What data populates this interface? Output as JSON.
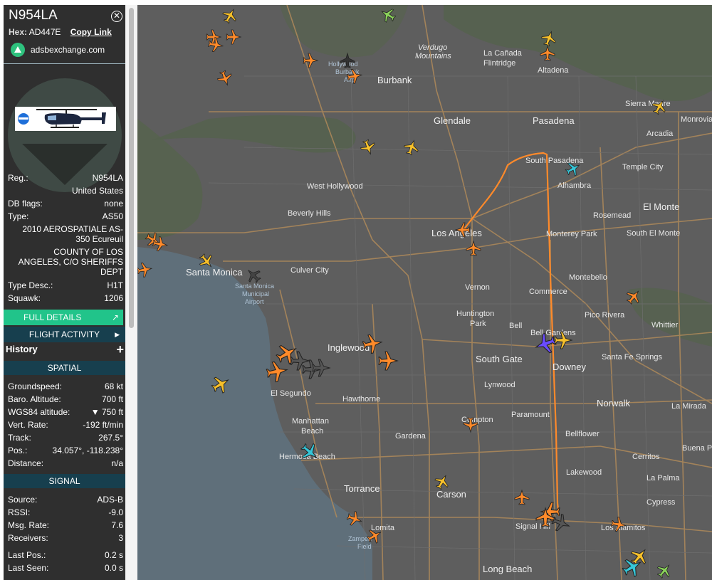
{
  "aircraft": {
    "callsign": "N954LA",
    "hex_label": "Hex:",
    "hex": "AD447E",
    "copy_link": "Copy Link",
    "source_site": "adsbexchange.com"
  },
  "details": {
    "reg_label": "Reg.:",
    "reg": "N954LA",
    "country": "United States",
    "db_flags_label": "DB flags:",
    "db_flags": "none",
    "type_label": "Type:",
    "type": "AS50",
    "model_line1": "2010 AEROSPATIALE AS-",
    "model_line2": "350 Ecureuil",
    "owner_line1": "COUNTY OF LOS",
    "owner_line2": "ANGELES, C/O SHERIFFS",
    "owner_line3": "DEPT",
    "type_desc_label": "Type Desc.:",
    "type_desc": "H1T",
    "squawk_label": "Squawk:",
    "squawk": "1206"
  },
  "buttons": {
    "full_details": "FULL DETAILS",
    "flight_activity": "FLIGHT ACTIVITY",
    "history": "History",
    "plus": "+"
  },
  "spatial": {
    "title": "SPATIAL",
    "groundspeed_label": "Groundspeed:",
    "groundspeed": "68 kt",
    "baro_label": "Baro. Altitude:",
    "baro": "700 ft",
    "wgs_label": "WGS84 altitude:",
    "wgs": "▼ 750 ft",
    "vrate_label": "Vert. Rate:",
    "vrate": "-192 ft/min",
    "track_label": "Track:",
    "track": "267.5°",
    "pos_label": "Pos.:",
    "pos": "34.057°, -118.238°",
    "distance_label": "Distance:",
    "distance": "n/a"
  },
  "signal": {
    "title": "SIGNAL",
    "source_label": "Source:",
    "source": "ADS-B",
    "rssi_label": "RSSI:",
    "rssi": "-9.0",
    "msgrate_label": "Msg. Rate:",
    "msgrate": "7.6",
    "receivers_label": "Receivers:",
    "receivers": "3",
    "lastpos_label": "Last Pos.:",
    "lastpos": "0.2 s",
    "lastseen_label": "Last Seen:",
    "lastseen": "0.0 s"
  },
  "colors": {
    "track": "#ff8a2a",
    "plane_orange": "#ff8a2a",
    "plane_yellow": "#f6c02b",
    "plane_cyan": "#36c6d8",
    "plane_selected": "#6a4cff",
    "land": "#5e5e5e",
    "water": "#5f6f7a"
  },
  "map_labels": {
    "burbank": "Burbank",
    "glendale": "Glendale",
    "pasadena": "Pasadena",
    "altadena": "Altadena",
    "lacanada": "La Cañada",
    "flintridge": "Flintridge",
    "verdugo": "Verdugo",
    "mountains": "Mountains",
    "sierramadre": "Sierra Madre",
    "monrovia": "Monrovia",
    "arcadia": "Arcadia",
    "southpasadena": "South Pasadena",
    "templecity": "Temple City",
    "alhambra": "Alhambra",
    "elmonte": "El Monte",
    "rosemead": "Rosemead",
    "southelmonte": "South El Monte",
    "montereypark": "Monterey Park",
    "montebello": "Montebello",
    "westhollywood": "West Hollywood",
    "beverlyhills": "Beverly Hills",
    "losangeles": "Los Angeles",
    "santamonica": "Santa Monica",
    "culvercity": "Culver City",
    "smairport1": "Santa Monica",
    "smairport2": "Municipal",
    "smairport3": "Airport",
    "vernon": "Vernon",
    "commerce": "Commerce",
    "picorivera": "Pico Rivera",
    "whittier": "Whittier",
    "huntington": "Huntington",
    "park": "Park",
    "bell": "Bell",
    "bellgardens": "Bell Gardens",
    "southgate": "South Gate",
    "downey": "Downey",
    "santafesprings": "Santa Fe Springs",
    "inglewood": "Inglewood",
    "elsegundo": "El Segundo",
    "lynwood": "Lynwood",
    "hawthorne": "Hawthorne",
    "norwalk": "Norwalk",
    "lamirada": "La Mirada",
    "paramount": "Paramount",
    "bellflower": "Bellflower",
    "compton": "Compton",
    "manhattan": "Manhattan",
    "beach": "Beach",
    "gardena": "Gardena",
    "hermosa": "Hermosa Beach",
    "cerritos": "Cerritos",
    "buenapark": "Buena P",
    "lakewood": "Lakewood",
    "lapalma": "La Palma",
    "torrance": "Torrance",
    "carson": "Carson",
    "cypress": "Cypress",
    "signalhill": "Signal Hill",
    "losalamitos": "Los Alamitos",
    "lomita": "Lomita",
    "zamperini1": "Zamperi",
    "zamperini2": "Field",
    "longbeach": "Long Beach",
    "hollywood1": "Hollywood",
    "hollywood2": "Burbank",
    "hollywood3": "Airp"
  }
}
